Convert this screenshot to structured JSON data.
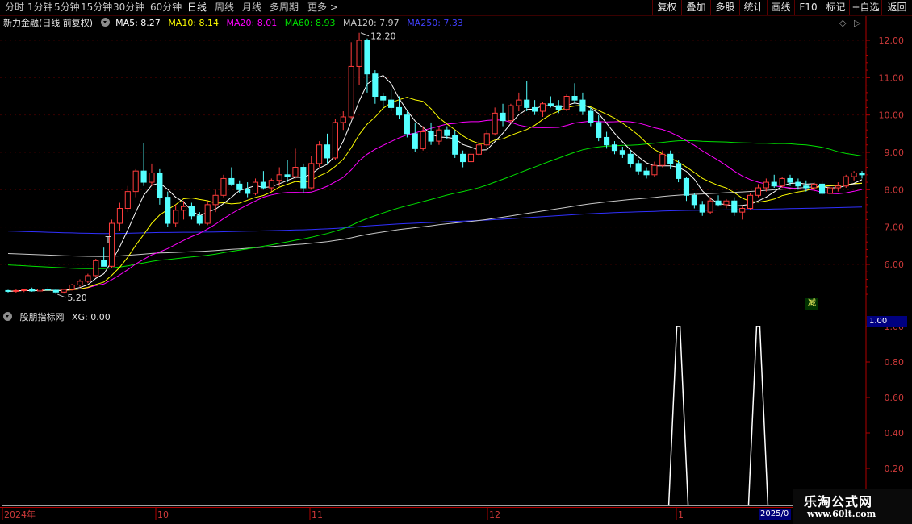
{
  "toolbar": {
    "periods": [
      "分时",
      "1分钟",
      "5分钟",
      "15分钟",
      "30分钟",
      "60分钟",
      "日线",
      "周线",
      "月线",
      "多周期",
      "更多"
    ],
    "more_arrow": ">",
    "active_index": 6,
    "right_buttons": [
      "复权",
      "叠加",
      "多股",
      "统计",
      "画线",
      "F10",
      "标记",
      "+自选",
      "返回"
    ]
  },
  "main_legend": {
    "title": "新力金融(日线 前复权)",
    "ma": [
      {
        "label": "MA5: 8.27",
        "color": "#ffffff"
      },
      {
        "label": "MA10: 8.14",
        "color": "#ffff00"
      },
      {
        "label": "MA20: 8.01",
        "color": "#ff00ff"
      },
      {
        "label": "MA60: 8.93",
        "color": "#00e000"
      },
      {
        "label": "MA120: 7.97",
        "color": "#c8c8c8"
      },
      {
        "label": "MA250: 7.33",
        "color": "#4040ff"
      }
    ]
  },
  "sub_legend": {
    "title": "股朋指标网",
    "value": "XG: 0.00",
    "badge": "1.00"
  },
  "price_axis": [
    "12.00",
    "11.00",
    "10.00",
    "9.00",
    "8.00",
    "7.00",
    "6.00"
  ],
  "indicator_axis": [
    "1.00",
    "0.80",
    "0.60",
    "0.40",
    "0.20"
  ],
  "date_axis": [
    "2024年",
    "10",
    "11",
    "12",
    "1"
  ],
  "year_badge": "2025/0",
  "annotations": {
    "high": "12.20",
    "low": "5.20",
    "t_mark": "T",
    "jian": "减"
  },
  "watermark": {
    "title": "乐淘公式网",
    "url": "www.60lt.com"
  },
  "colors": {
    "up": "#ff3c3c",
    "down": "#54ffff",
    "axis": "#b00000",
    "ma5": "#ffffff",
    "ma10": "#ffff00",
    "ma20": "#ff00ff",
    "ma60": "#00e000",
    "ma120": "#c8c8c8",
    "ma250": "#3030ff"
  },
  "candles": [
    [
      5.3,
      5.32,
      5.25,
      5.28
    ],
    [
      5.28,
      5.33,
      5.24,
      5.3
    ],
    [
      5.3,
      5.35,
      5.26,
      5.32
    ],
    [
      5.32,
      5.38,
      5.27,
      5.29
    ],
    [
      5.29,
      5.36,
      5.25,
      5.34
    ],
    [
      5.34,
      5.4,
      5.3,
      5.31
    ],
    [
      5.31,
      5.35,
      5.2,
      5.26
    ],
    [
      5.26,
      5.34,
      5.22,
      5.33
    ],
    [
      5.33,
      5.48,
      5.3,
      5.45
    ],
    [
      5.45,
      5.6,
      5.4,
      5.55
    ],
    [
      5.55,
      5.75,
      5.5,
      5.7
    ],
    [
      5.7,
      6.15,
      5.65,
      6.1
    ],
    [
      6.1,
      6.45,
      6.0,
      5.95
    ],
    [
      5.95,
      7.2,
      5.9,
      7.1
    ],
    [
      7.1,
      7.65,
      6.9,
      7.5
    ],
    [
      7.5,
      8.1,
      7.4,
      7.95
    ],
    [
      7.95,
      8.55,
      7.8,
      8.5
    ],
    [
      8.5,
      9.25,
      8.1,
      8.2
    ],
    [
      8.2,
      8.7,
      8.1,
      8.45
    ],
    [
      8.45,
      8.55,
      7.6,
      7.8
    ],
    [
      7.8,
      7.95,
      7.0,
      7.1
    ],
    [
      7.1,
      7.6,
      7.0,
      7.45
    ],
    [
      7.45,
      7.7,
      7.2,
      7.55
    ],
    [
      7.55,
      7.65,
      7.2,
      7.3
    ],
    [
      7.3,
      7.4,
      7.05,
      7.1
    ],
    [
      7.1,
      7.7,
      7.05,
      7.6
    ],
    [
      7.6,
      8.0,
      7.4,
      7.85
    ],
    [
      7.85,
      8.4,
      7.8,
      8.3
    ],
    [
      8.3,
      8.6,
      8.1,
      8.15
    ],
    [
      8.15,
      8.25,
      7.9,
      8.0
    ],
    [
      8.0,
      8.2,
      7.8,
      7.9
    ],
    [
      7.9,
      8.3,
      7.85,
      8.2
    ],
    [
      8.2,
      8.5,
      8.0,
      8.05
    ],
    [
      8.05,
      8.3,
      7.95,
      8.25
    ],
    [
      8.25,
      8.6,
      8.1,
      8.4
    ],
    [
      8.4,
      8.8,
      8.2,
      8.35
    ],
    [
      8.35,
      9.1,
      8.3,
      8.6
    ],
    [
      8.6,
      8.7,
      7.9,
      8.05
    ],
    [
      8.05,
      8.9,
      8.0,
      8.7
    ],
    [
      8.7,
      9.3,
      8.6,
      9.2
    ],
    [
      9.2,
      9.5,
      8.7,
      8.85
    ],
    [
      8.85,
      9.9,
      8.8,
      9.8
    ],
    [
      9.8,
      10.1,
      9.6,
      9.95
    ],
    [
      9.95,
      11.95,
      9.9,
      11.3
    ],
    [
      11.3,
      12.2,
      10.8,
      12.0
    ],
    [
      12.0,
      12.05,
      10.6,
      11.1
    ],
    [
      11.1,
      11.2,
      10.3,
      10.5
    ],
    [
      10.5,
      10.6,
      10.2,
      10.4
    ],
    [
      10.4,
      10.7,
      10.1,
      10.2
    ],
    [
      10.2,
      10.5,
      9.9,
      10.0
    ],
    [
      10.0,
      10.1,
      9.4,
      9.5
    ],
    [
      9.5,
      9.8,
      9.0,
      9.1
    ],
    [
      9.1,
      9.7,
      9.05,
      9.55
    ],
    [
      9.55,
      9.8,
      9.2,
      9.3
    ],
    [
      9.3,
      9.7,
      9.2,
      9.6
    ],
    [
      9.6,
      9.7,
      9.35,
      9.45
    ],
    [
      9.45,
      9.6,
      8.85,
      8.95
    ],
    [
      8.95,
      9.05,
      8.6,
      8.75
    ],
    [
      8.75,
      9.0,
      8.7,
      8.95
    ],
    [
      8.95,
      9.3,
      8.9,
      9.2
    ],
    [
      9.2,
      9.6,
      9.1,
      9.5
    ],
    [
      9.5,
      10.2,
      9.45,
      10.05
    ],
    [
      10.05,
      10.3,
      9.7,
      9.85
    ],
    [
      9.85,
      10.3,
      9.8,
      10.25
    ],
    [
      10.25,
      10.6,
      10.1,
      10.4
    ],
    [
      10.4,
      10.9,
      10.1,
      10.2
    ],
    [
      10.2,
      10.4,
      10.0,
      10.1
    ],
    [
      10.1,
      10.35,
      9.95,
      10.3
    ],
    [
      10.3,
      10.5,
      10.2,
      10.25
    ],
    [
      10.25,
      10.4,
      10.05,
      10.15
    ],
    [
      10.15,
      10.55,
      10.1,
      10.5
    ],
    [
      10.5,
      10.85,
      10.3,
      10.4
    ],
    [
      10.4,
      10.6,
      10.0,
      10.1
    ],
    [
      10.1,
      10.2,
      9.7,
      9.8
    ],
    [
      9.8,
      10.0,
      9.3,
      9.4
    ],
    [
      9.4,
      9.55,
      9.1,
      9.2
    ],
    [
      9.2,
      9.3,
      8.95,
      9.05
    ],
    [
      9.05,
      9.15,
      8.85,
      8.95
    ],
    [
      8.95,
      9.05,
      8.6,
      8.7
    ],
    [
      8.7,
      8.8,
      8.4,
      8.5
    ],
    [
      8.5,
      8.6,
      8.3,
      8.4
    ],
    [
      8.4,
      8.75,
      8.35,
      8.65
    ],
    [
      8.65,
      9.05,
      8.6,
      8.95
    ],
    [
      8.95,
      9.05,
      8.55,
      8.7
    ],
    [
      8.7,
      8.8,
      8.2,
      8.3
    ],
    [
      8.3,
      8.35,
      7.7,
      7.85
    ],
    [
      7.85,
      7.9,
      7.5,
      7.6
    ],
    [
      7.6,
      7.7,
      7.3,
      7.4
    ],
    [
      7.4,
      7.8,
      7.35,
      7.7
    ],
    [
      7.7,
      7.85,
      7.55,
      7.6
    ],
    [
      7.6,
      7.75,
      7.5,
      7.7
    ],
    [
      7.7,
      7.8,
      7.3,
      7.4
    ],
    [
      7.4,
      7.55,
      7.2,
      7.5
    ],
    [
      7.5,
      7.9,
      7.45,
      7.85
    ],
    [
      7.85,
      8.15,
      7.8,
      8.05
    ],
    [
      8.05,
      8.3,
      7.95,
      8.2
    ],
    [
      8.2,
      8.4,
      8.05,
      8.1
    ],
    [
      8.1,
      8.35,
      8.05,
      8.3
    ],
    [
      8.3,
      8.4,
      8.1,
      8.2
    ],
    [
      8.2,
      8.3,
      8.0,
      8.1
    ],
    [
      8.1,
      8.25,
      7.95,
      8.05
    ],
    [
      8.05,
      8.2,
      7.95,
      8.15
    ],
    [
      8.15,
      8.25,
      7.85,
      7.9
    ],
    [
      7.9,
      8.1,
      7.85,
      8.05
    ],
    [
      8.05,
      8.2,
      7.95,
      8.1
    ],
    [
      8.1,
      8.4,
      8.05,
      8.35
    ],
    [
      8.35,
      8.5,
      8.25,
      8.45
    ],
    [
      8.45,
      8.5,
      8.3,
      8.4
    ]
  ],
  "xg_signals": [
    84,
    94
  ]
}
